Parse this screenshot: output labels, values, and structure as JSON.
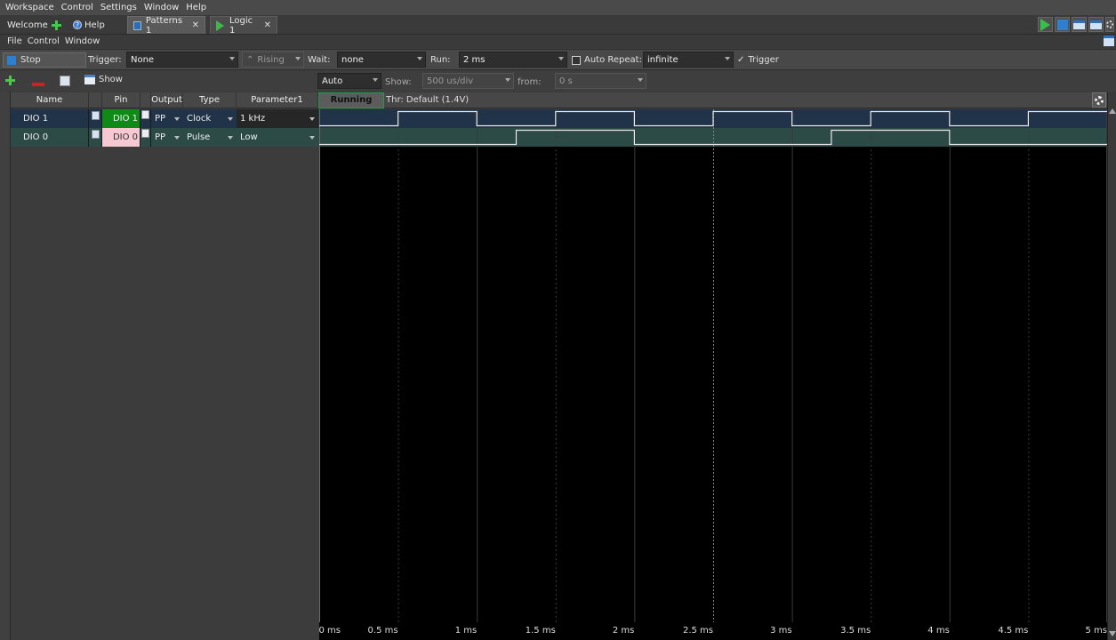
{
  "menu": {
    "items": [
      "Workspace",
      "Control",
      "Settings",
      "Window",
      "Help"
    ]
  },
  "tabs": [
    {
      "label": "Welcome",
      "icon": "plus-icon"
    },
    {
      "label": "Help",
      "icon": "help-icon"
    },
    {
      "label": "Patterns 1",
      "icon": "patterns-icon",
      "closable": true
    },
    {
      "label": "Logic 1",
      "icon": "logic-icon",
      "closable": true
    }
  ],
  "submenu": [
    "File",
    "Control",
    "Window"
  ],
  "control": {
    "stop_label": "Stop",
    "trigger_label": "Trigger:",
    "trigger_value": "None",
    "edge_value": "Rising",
    "wait_label": "Wait:",
    "wait_value": "none",
    "run_label": "Run:",
    "run_value": "2 ms",
    "auto_repeat_label": "Auto Repeat:",
    "repeat_value": "infinite",
    "trigger_check_label": "Trigger",
    "trigger_check_mark": "✓"
  },
  "toolbar": {
    "show_label": "Show",
    "mode_value": "Auto",
    "show_label2": "Show:",
    "show_value": "500 us/div",
    "from_label": "from:",
    "from_value": "0 s"
  },
  "table": {
    "headers": [
      "Name",
      "Pin",
      "Output",
      "Type",
      "Parameter1"
    ],
    "rows": [
      {
        "name": "DIO 1",
        "pin": "DIO 1",
        "output": "PP",
        "type": "Clock",
        "param": "1 kHz"
      },
      {
        "name": "DIO 0",
        "pin": "DIO 0",
        "output": "PP",
        "type": "Pulse",
        "param": "Low"
      }
    ]
  },
  "status": {
    "running": "Running",
    "threshold": "Thr: Default (1.4V)"
  },
  "chart_data": {
    "type": "line",
    "x_unit": "ms",
    "xlim": [
      0,
      5
    ],
    "ticks": [
      "0 ms",
      "0.5 ms",
      "1 ms",
      "1.5 ms",
      "2 ms",
      "2.5 ms",
      "3 ms",
      "3.5 ms",
      "4 ms",
      "4.5 ms",
      "5 ms"
    ],
    "tick_values": [
      0,
      0.5,
      1,
      1.5,
      2,
      2.5,
      3,
      3.5,
      4,
      4.5,
      5
    ],
    "series": [
      {
        "name": "DIO 1",
        "color": "#203349",
        "transitions": [
          [
            0,
            0
          ],
          [
            0.5,
            1
          ],
          [
            1,
            0
          ],
          [
            1.5,
            1
          ],
          [
            2,
            0
          ],
          [
            2.5,
            1
          ],
          [
            3,
            0
          ],
          [
            3.5,
            1
          ],
          [
            4,
            0
          ],
          [
            4.5,
            1
          ],
          [
            5,
            1
          ]
        ]
      },
      {
        "name": "DIO 0",
        "color": "#2c4a46",
        "transitions": [
          [
            0,
            0
          ],
          [
            1.25,
            1
          ],
          [
            2,
            0
          ],
          [
            3.25,
            1
          ],
          [
            4,
            0
          ],
          [
            5,
            0
          ]
        ]
      }
    ]
  }
}
